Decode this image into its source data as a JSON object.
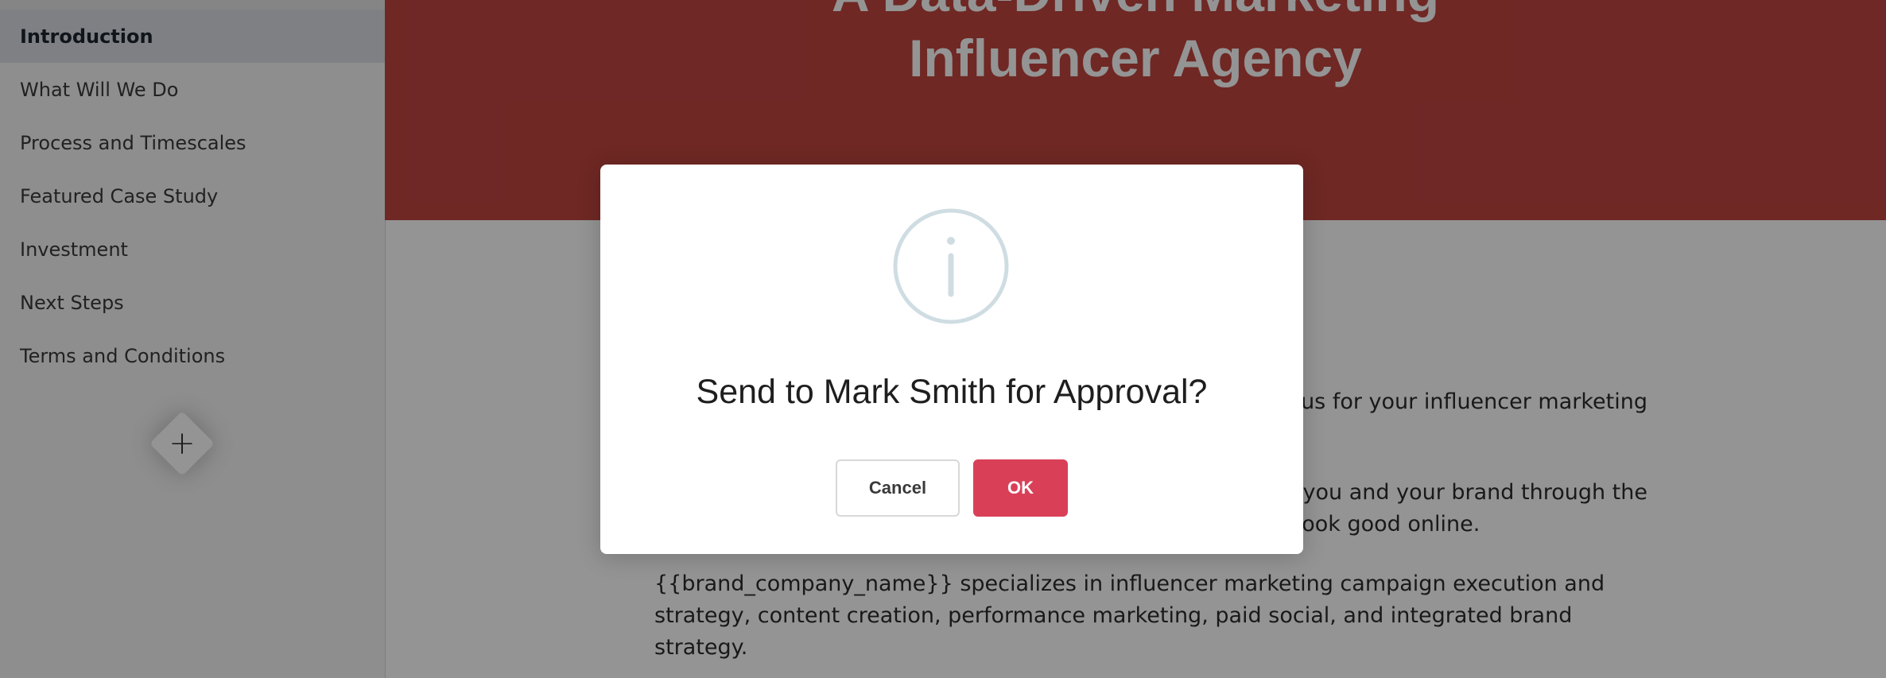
{
  "sidebar": {
    "items": [
      {
        "label": "Introduction",
        "active": true
      },
      {
        "label": "What Will We Do",
        "active": false
      },
      {
        "label": "Process and Timescales",
        "active": false
      },
      {
        "label": "Featured Case Study",
        "active": false
      },
      {
        "label": "Investment",
        "active": false
      },
      {
        "label": "Next Steps",
        "active": false
      },
      {
        "label": "Terms and Conditions",
        "active": false
      }
    ],
    "add_section_icon": "plus-icon",
    "add_section_symbol": "+"
  },
  "hero": {
    "title_line1": "A Data-Driven Marketing",
    "title_line2": "Influencer Agency",
    "background_color": "#c0453f"
  },
  "content": {
    "paragraph1_visible": "g us for your influencer marketing",
    "paragraph2_line1_visible": "le you and your brand through the",
    "paragraph2_line2_visible": "u look good online.",
    "paragraph3": "{{brand_company_name}} specializes in influencer marketing campaign execution and strategy, content creation, performance marketing, paid social, and integrated brand strategy."
  },
  "modal": {
    "icon": "info-icon",
    "title": "Send to Mark Smith for Approval?",
    "cancel_label": "Cancel",
    "ok_label": "OK",
    "ok_color": "#d94058"
  }
}
